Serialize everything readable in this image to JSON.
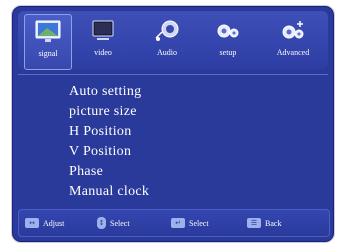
{
  "tabs": [
    {
      "label": "signal",
      "icon": "monitor-icon",
      "active": true
    },
    {
      "label": "video",
      "icon": "tv-icon",
      "active": false
    },
    {
      "label": "Audio",
      "icon": "speaker-icon",
      "active": false
    },
    {
      "label": "setup",
      "icon": "gears-icon",
      "active": false
    },
    {
      "label": "Advanced",
      "icon": "gears-plus-icon",
      "active": false
    }
  ],
  "menu": {
    "items": [
      "Auto  setting",
      "picture  size",
      "H Position",
      "V Position",
      "Phase",
      "Manual clock"
    ]
  },
  "footer": {
    "adjust_label": "Adjust",
    "select1_label": "Select",
    "select2_label": "Select",
    "back_label": "Back"
  },
  "colors": {
    "panel": "#2a3a9b",
    "text": "#ffffff"
  }
}
